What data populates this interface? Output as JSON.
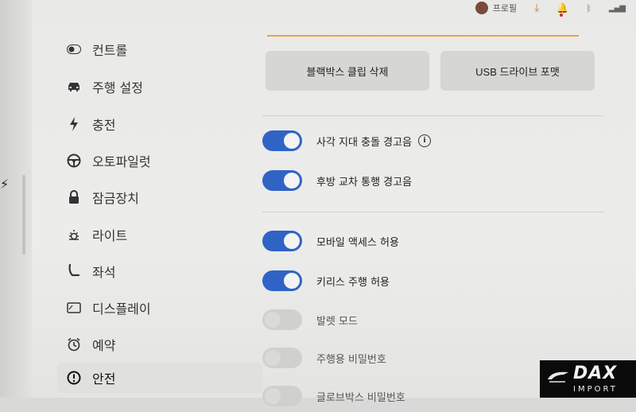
{
  "status_bar": {
    "user_name": "프로필",
    "icons": [
      "avatar",
      "download-icon",
      "bell-icon",
      "bluetooth-icon",
      "signal-icon"
    ]
  },
  "sidebar": {
    "items": [
      {
        "label": "컨트롤",
        "icon": "toggle-icon"
      },
      {
        "label": "주행 설정",
        "icon": "car-icon"
      },
      {
        "label": "충전",
        "icon": "bolt-icon"
      },
      {
        "label": "오토파일럿",
        "icon": "steering-wheel-icon"
      },
      {
        "label": "잠금장치",
        "icon": "lock-icon"
      },
      {
        "label": "라이트",
        "icon": "sun-icon"
      },
      {
        "label": "좌석",
        "icon": "seat-icon"
      },
      {
        "label": "디스플레이",
        "icon": "display-icon"
      },
      {
        "label": "예약",
        "icon": "alarm-clock-icon"
      },
      {
        "label": "안전",
        "icon": "alert-circle-icon",
        "active": true
      }
    ]
  },
  "actions": {
    "delete_dashcam_clips": "블랙박스 클립 삭제",
    "format_usb": "USB 드라이브 포맷"
  },
  "settings": [
    {
      "label": "사각 지대 충돌 경고음",
      "on": true,
      "info": true
    },
    {
      "label": "후방 교차 통행 경고음",
      "on": true
    },
    {
      "label": "모바일 액세스 허용",
      "on": true
    },
    {
      "label": "키리스 주행 허용",
      "on": true
    },
    {
      "label": "발렛 모드",
      "on": false
    },
    {
      "label": "주행용 비밀번호",
      "on": false
    },
    {
      "label": "글로브박스 비밀번호",
      "on": false
    }
  ],
  "info_glyph": "i",
  "watermark": {
    "brand": "DAX",
    "sub": "IMPORT"
  },
  "colors": {
    "toggle_on": "#2f63c5",
    "accent_line": "#e8a44a",
    "logo_bg": "#0b0b0b"
  }
}
